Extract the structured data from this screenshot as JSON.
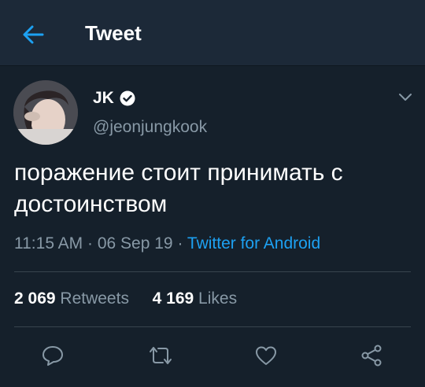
{
  "header": {
    "title": "Tweet",
    "back_icon": "arrow-left-icon",
    "accent": "#1da1f2"
  },
  "tweet": {
    "author": {
      "name": "JK",
      "handle": "@jeonjungkook",
      "verified": true
    },
    "text": "поражение стоит принимать с достоинством",
    "time": "11:15 AM",
    "date": "06 Sep 19",
    "source": "Twitter for Android",
    "retweets_count": "2 069",
    "retweets_label": "Retweets",
    "likes_count": "4 169",
    "likes_label": "Likes"
  },
  "actions": [
    "reply-icon",
    "retweet-icon",
    "like-icon",
    "share-icon"
  ],
  "colors": {
    "background": "#15202b",
    "header_bg": "#1c2938",
    "secondary_text": "#8899a6",
    "link": "#1da1f2",
    "divider": "#38444d"
  }
}
